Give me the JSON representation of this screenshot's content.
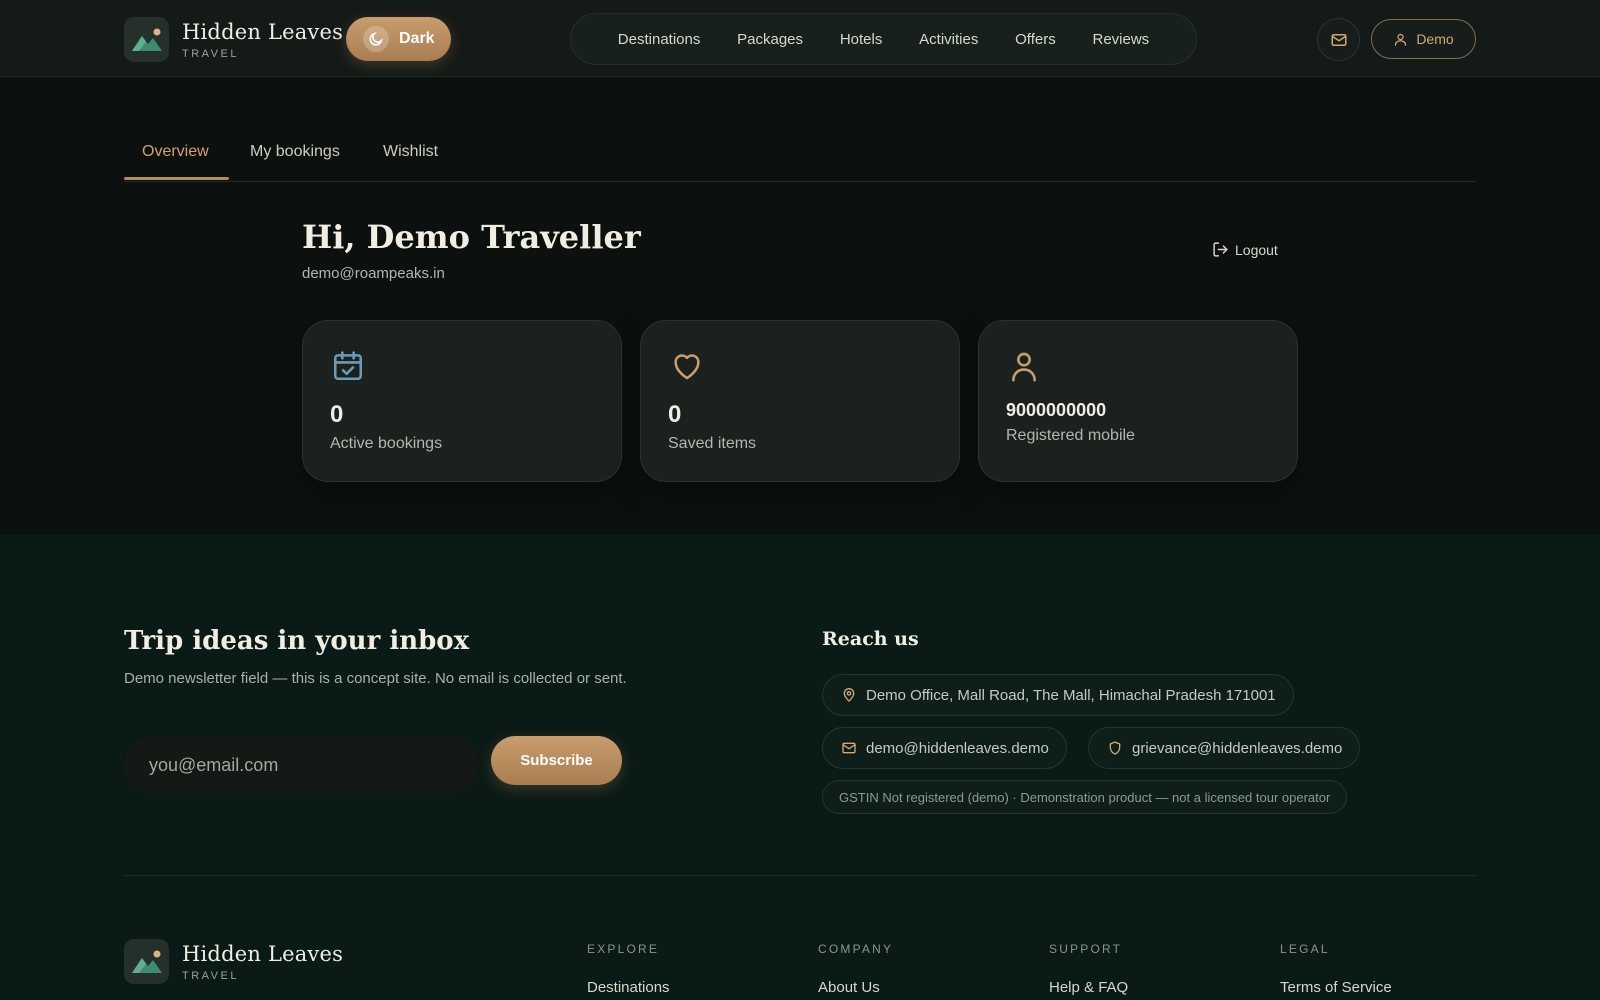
{
  "header": {
    "brand_name": "Hidden Leaves",
    "brand_sub": "TRAVEL",
    "theme_toggle_label": "Dark",
    "nav": [
      "Destinations",
      "Packages",
      "Hotels",
      "Activities",
      "Offers",
      "Reviews"
    ],
    "user_label": "Demo"
  },
  "tabs": [
    "Overview",
    "My bookings",
    "Wishlist"
  ],
  "account": {
    "greeting": "Hi, Demo Traveller",
    "email": "demo@roampeaks.in",
    "logout_label": "Logout"
  },
  "stats": [
    {
      "icon": "calendar-check-icon",
      "value": "0",
      "label": "Active bookings"
    },
    {
      "icon": "heart-icon",
      "value": "0",
      "label": "Saved items"
    },
    {
      "icon": "user-icon",
      "value": "9000000000",
      "label": "Registered mobile"
    }
  ],
  "newsletter": {
    "title": "Trip ideas in your inbox",
    "description": "Demo newsletter field — this is a concept site. No email is collected or sent.",
    "placeholder": "you@email.com",
    "button_label": "Subscribe"
  },
  "reach_us": {
    "title": "Reach us",
    "address": "Demo Office, Mall Road, The Mall, Himachal Pradesh 171001",
    "email": "demo@hiddenleaves.demo",
    "grievance_email": "grievance@hiddenleaves.demo",
    "legal_note": "GSTIN Not registered (demo) · Demonstration product — not a licensed tour operator"
  },
  "footer": {
    "brand_name": "Hidden Leaves",
    "brand_sub": "TRAVEL",
    "columns": [
      {
        "heading": "EXPLORE",
        "first_link": "Destinations"
      },
      {
        "heading": "COMPANY",
        "first_link": "About Us"
      },
      {
        "heading": "SUPPORT",
        "first_link": "Help & FAQ"
      },
      {
        "heading": "LEGAL",
        "first_link": "Terms of Service"
      }
    ]
  },
  "colors": {
    "accent": "#c99d6c",
    "accent_text": "#d4a16c",
    "calendar_icon": "#6e9bb4",
    "heart_icon": "#c99d6c",
    "footer_bg": "#0a1a16"
  }
}
